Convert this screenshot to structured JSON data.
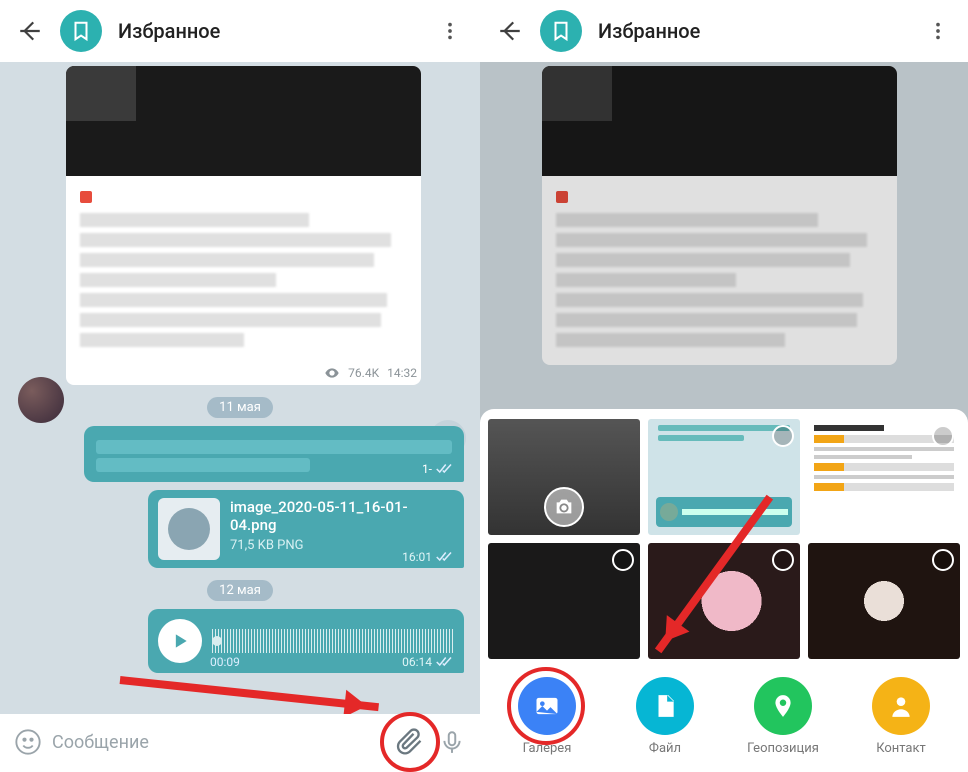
{
  "left": {
    "header_title": "Избранное",
    "views": "76.4K",
    "views_time": "14:32",
    "date1": "11 мая",
    "sent1_time": "1-",
    "file": {
      "name": "image_2020-05-11_16-01-04.png",
      "meta": "71,5 KB PNG",
      "time": "16:01"
    },
    "date2": "12 мая",
    "voice": {
      "cur": "00:09",
      "end": "06:14"
    },
    "input_placeholder": "Сообщение"
  },
  "right": {
    "header_title": "Избранное",
    "actions": {
      "gallery": "Галерея",
      "file": "Файл",
      "location": "Геопозиция",
      "contact": "Контакт"
    }
  }
}
